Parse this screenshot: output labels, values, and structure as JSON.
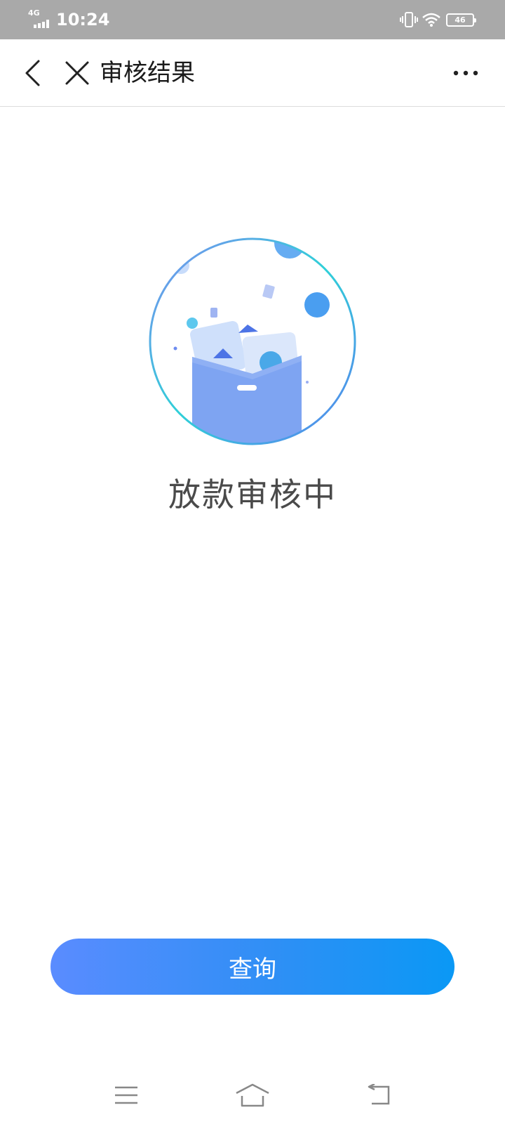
{
  "status_bar": {
    "network": "4G",
    "time": "10:24",
    "battery": "46"
  },
  "nav": {
    "title": "审核结果",
    "icons": {
      "back": "chevron-left-icon",
      "close": "close-icon",
      "more": "more-horizontal-icon"
    }
  },
  "main": {
    "status_text": "放款审核中",
    "query_button": "查询"
  },
  "colors": {
    "button_gradient_start": "#5a8cff",
    "button_gradient_end": "#0a98f5",
    "illustration_blue": "#7da2f5",
    "ring_teal": "#2fd0d8"
  }
}
